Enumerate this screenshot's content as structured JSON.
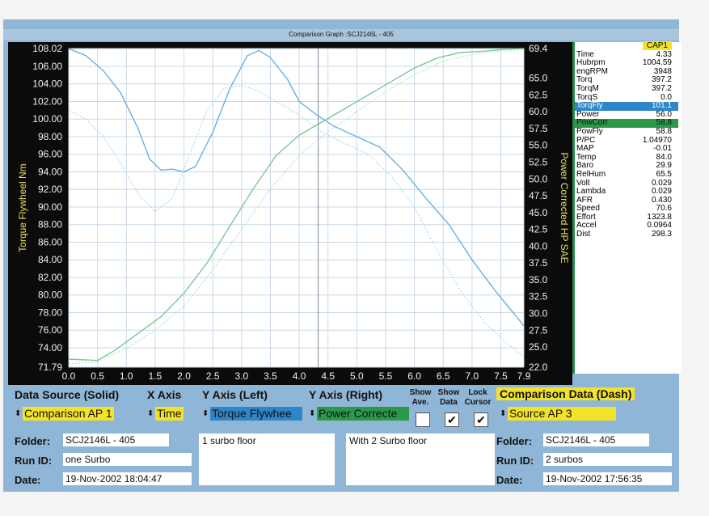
{
  "window": {
    "title": "Comparison Graph :SCJ2146L - 405"
  },
  "chart_data": {
    "type": "line",
    "x_ticks": [
      "0.0",
      "0.5",
      "1.0",
      "1.5",
      "2.0",
      "2.5",
      "3.0",
      "3.5",
      "4.0",
      "4.5",
      "5.0",
      "5.5",
      "6.0",
      "6.5",
      "7.0",
      "7.5",
      "7.9"
    ],
    "y_left_ticks": [
      "108.02",
      "106.00",
      "104.00",
      "102.00",
      "100.00",
      "98.00",
      "96.00",
      "94.00",
      "92.00",
      "90.00",
      "88.00",
      "86.00",
      "84.00",
      "82.00",
      "80.00",
      "78.00",
      "76.00",
      "74.00",
      "71.79"
    ],
    "y_right_ticks": [
      "69.4",
      "65.0",
      "62.5",
      "60.0",
      "57.5",
      "55.0",
      "52.5",
      "50.0",
      "47.5",
      "45.0",
      "42.5",
      "40.0",
      "37.5",
      "35.0",
      "32.5",
      "30.0",
      "27.5",
      "25.0",
      "22.0"
    ],
    "ylabel_left": "Torque Flywheel Nm",
    "ylabel_right": "Power Corrected HP SAE",
    "xlim": [
      0,
      7.9
    ],
    "ylim_left": [
      71.79,
      108.02
    ],
    "ylim_right": [
      22.0,
      69.4
    ],
    "grid": true,
    "series": [
      {
        "axis": "left",
        "style": "solid",
        "color": "#6ab0e0",
        "x": [
          0,
          0.3,
          0.6,
          0.9,
          1.2,
          1.4,
          1.6,
          1.8,
          2.0,
          2.2,
          2.5,
          2.8,
          3.1,
          3.3,
          3.5,
          3.8,
          4.0,
          4.3,
          4.6,
          5.0,
          5.4,
          5.8,
          6.2,
          6.6,
          7.0,
          7.4,
          7.9
        ],
        "y": [
          108.0,
          107.2,
          105.5,
          103.0,
          99.0,
          95.5,
          94.2,
          94.3,
          94.0,
          94.6,
          98.5,
          103.5,
          107.2,
          107.8,
          107.0,
          104.5,
          102.0,
          100.5,
          99.2,
          98.0,
          96.8,
          94.2,
          91.0,
          88.0,
          84.0,
          80.5,
          76.5
        ]
      },
      {
        "axis": "left",
        "style": "dash",
        "color": "#a8d8e8",
        "x": [
          0,
          0.3,
          0.6,
          0.9,
          1.2,
          1.5,
          1.8,
          2.1,
          2.4,
          2.7,
          3.0,
          3.3,
          3.6,
          4.0,
          4.4,
          4.8,
          5.2,
          5.6,
          6.0,
          6.4,
          6.8,
          7.2,
          7.6,
          7.9
        ],
        "y": [
          101.0,
          100.0,
          98.0,
          95.0,
          91.5,
          89.5,
          91.0,
          96.0,
          101.0,
          103.5,
          103.8,
          103.2,
          102.0,
          100.5,
          98.5,
          97.2,
          96.0,
          93.5,
          90.0,
          85.0,
          80.5,
          77.0,
          74.5,
          73.0
        ]
      },
      {
        "axis": "right",
        "style": "solid",
        "color": "#7cc890",
        "x": [
          0,
          0.5,
          0.8,
          1.2,
          1.6,
          2.0,
          2.4,
          2.8,
          3.2,
          3.6,
          4.0,
          4.4,
          4.8,
          5.2,
          5.6,
          6.0,
          6.4,
          6.8,
          7.2,
          7.6,
          7.9
        ],
        "y": [
          23.2,
          23.0,
          24.5,
          27.0,
          29.5,
          33.0,
          37.5,
          43.0,
          48.5,
          53.5,
          56.5,
          58.5,
          60.5,
          62.5,
          64.5,
          66.5,
          68.0,
          68.8,
          69.0,
          69.3,
          69.4
        ]
      },
      {
        "axis": "right",
        "style": "dash",
        "color": "#b0e0c0",
        "x": [
          0,
          0.5,
          1.0,
          1.5,
          2.0,
          2.5,
          3.0,
          3.5,
          4.0,
          4.5,
          5.0,
          5.5,
          6.0,
          6.5,
          7.0,
          7.5,
          7.9
        ],
        "y": [
          22.5,
          22.8,
          24.8,
          27.5,
          31.0,
          36.5,
          42.5,
          48.5,
          53.5,
          57.0,
          60.0,
          63.0,
          65.5,
          67.5,
          68.5,
          69.0,
          69.2
        ]
      }
    ]
  },
  "sidebar": {
    "cap": "CAP1",
    "rows": [
      {
        "label": "Time",
        "value": "4.33"
      },
      {
        "label": "Hubrpm",
        "value": "1004.59"
      },
      {
        "label": "engRPM",
        "value": "3948"
      },
      {
        "label": "Torq",
        "value": "397.2"
      },
      {
        "label": "TorqM",
        "value": "397.2"
      },
      {
        "label": "TorqS",
        "value": "0.0"
      },
      {
        "label": "TorqFly",
        "value": "101.1"
      },
      {
        "label": "Power",
        "value": "56.0"
      },
      {
        "label": "PowCorr",
        "value": "58.8"
      },
      {
        "label": "PowFly",
        "value": "58.8"
      },
      {
        "label": "P/PC",
        "value": "1.04970"
      },
      {
        "label": "MAP",
        "value": "-0.01"
      },
      {
        "label": "Temp",
        "value": "84.0"
      },
      {
        "label": "Baro",
        "value": "29.9"
      },
      {
        "label": "RelHum",
        "value": "65.5"
      },
      {
        "label": "Volt",
        "value": "0.029"
      },
      {
        "label": "Lambda",
        "value": "0.029"
      },
      {
        "label": "AFR",
        "value": "0.430"
      },
      {
        "label": "Speed",
        "value": "70.6"
      },
      {
        "label": "Effort",
        "value": "1323.8"
      },
      {
        "label": "Accel",
        "value": "0.0964"
      },
      {
        "label": "Dist",
        "value": "298.3"
      }
    ]
  },
  "controls": {
    "data_source_label": "Data Source (Solid)",
    "x_axis_label": "X Axis",
    "y_left_label": "Y Axis (Left)",
    "y_right_label": "Y Axis (Right)",
    "show_ave_label": "Show Ave.",
    "show_data_label": "Show Data",
    "lock_cursor_label": "Lock Cursor",
    "comparison_label": "Comparison Data (Dash)",
    "data_source_value": "Comparison AP 1",
    "x_axis_value": "Time",
    "y_left_value": "Torque Flywhee",
    "y_right_value": "Power Correcte",
    "comparison_value": "Source AP 3",
    "show_ave_checked": "",
    "show_data_checked": "✔",
    "lock_cursor_checked": "✔",
    "left": {
      "folder_label": "Folder:",
      "folder": "SCJ2146L - 405",
      "run_label": "Run ID:",
      "run": "one Surbo",
      "date_label": "Date:",
      "date": "19-Nov-2002  18:04:47"
    },
    "notes_left": "1 surbo floor",
    "notes_right": "With 2 Surbo floor",
    "right": {
      "folder_label": "Folder:",
      "folder": "SCJ2146L - 405",
      "run_label": "Run ID:",
      "run": "2 surbos",
      "date_label": "Date:",
      "date": "19-Nov-2002  17:56:35"
    }
  }
}
